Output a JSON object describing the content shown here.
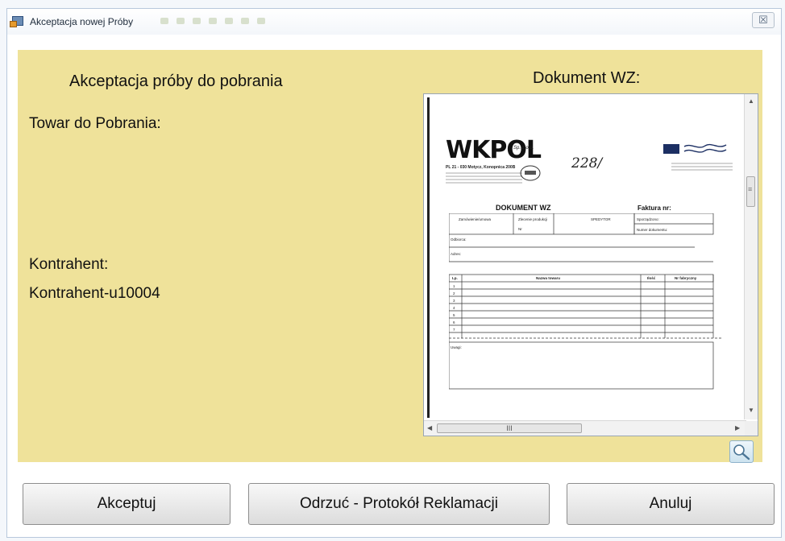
{
  "window": {
    "title": "Akceptacja nowej Próby",
    "close_glyph": "☒"
  },
  "panel": {
    "accept_title": "Akceptacja próby do pobrania",
    "towar_label": "Towar do Pobrania:",
    "kontrahent_label": "Kontrahent:",
    "kontrahent_value": "Kontrahent-u10004",
    "wz_title": "Dokument WZ:",
    "background_color": "#efe29a"
  },
  "document": {
    "company": "WKPOL",
    "company_suffix": "Sp. z o.o.",
    "address": "PL 21 - 030 Motycz, Konopnica 200B",
    "signature": "228/",
    "title": "DOKUMENT WZ",
    "faktura_label": "Faktura nr:",
    "col_zamowienie": "Zamówienie/umowa",
    "col_zlecenie": "Zlecenie produkcji",
    "col_nr": "Nr",
    "col_spedytor": "SPEDYTOR",
    "col_sporzadzono": "Sporządzono:",
    "col_numer": "Numer dokumentu:",
    "odbiorca": "Odbiorca:",
    "adres": "Adres:",
    "col_lp": "Lp.",
    "col_nazwa": "Nazwa towaru",
    "col_ilosc": "Ilość",
    "col_nr_fabr": "Nr fabryczny",
    "row_numbers": [
      "1",
      "2",
      "3",
      "4",
      "5",
      "6",
      "7"
    ],
    "uwagi": "Uwagi:",
    "hscroll_thumb": "III"
  },
  "buttons": {
    "accept": "Akceptuj",
    "reject": "Odrzuć - Protokół Reklamacji",
    "cancel": "Anuluj"
  },
  "icons": {
    "app": "form-icon",
    "zoom": "magnifier-icon"
  }
}
